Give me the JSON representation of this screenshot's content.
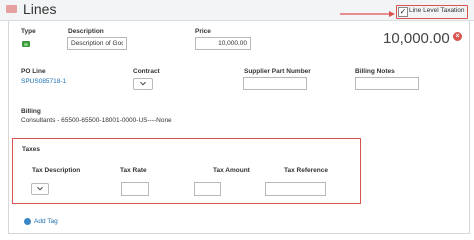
{
  "section": {
    "title": "Lines",
    "line_level_taxation_label": "Line Level Taxation",
    "line_level_taxation_checked": true,
    "annotation_color": "#d9534f"
  },
  "line": {
    "type_label": "Type",
    "type_icon": "money-icon",
    "description_label": "Description",
    "description_value": "Description of Goc",
    "price_label": "Price",
    "price_value": "10,000.00",
    "total_amount": "10,000.00"
  },
  "details": {
    "po_line_label": "PO Line",
    "po_line_value": "SPUS085718-1",
    "contract_label": "Contract",
    "supplier_part_label": "Supplier Part Number",
    "billing_notes_label": "Billing Notes",
    "billing_label": "Billing",
    "billing_value": "Consultants - 65500-65500-18001-0000-US----None"
  },
  "taxes": {
    "title": "Taxes",
    "columns": {
      "description": "Tax Description",
      "rate": "Tax Rate",
      "amount": "Tax Amount",
      "reference": "Tax Reference"
    }
  },
  "actions": {
    "add_tag": "Add Tag"
  }
}
